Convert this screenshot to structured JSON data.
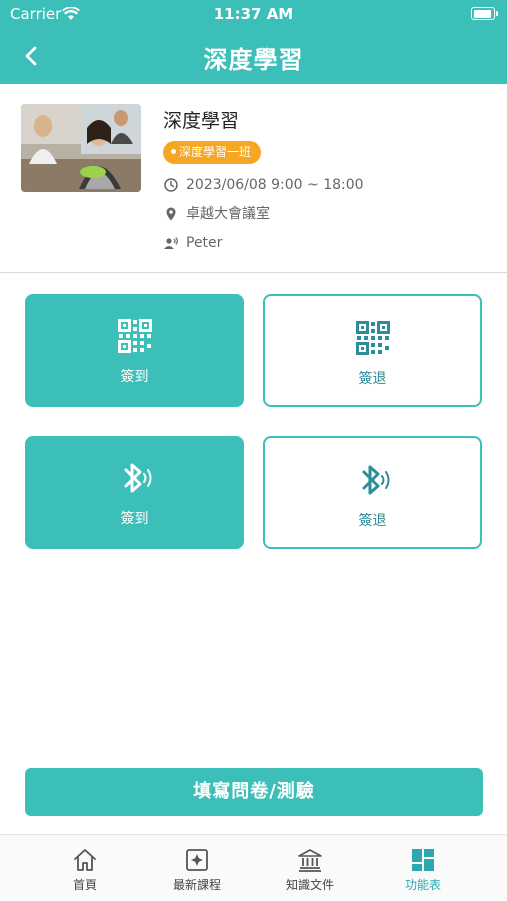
{
  "status_bar": {
    "carrier": "Carrier",
    "time": "11:37 AM"
  },
  "nav": {
    "title": "深度學習"
  },
  "course": {
    "title": "深度學習",
    "class_badge": "深度學習一班",
    "datetime": "2023/06/08 9:00 ~ 18:00",
    "location": "卓越大會議室",
    "instructor": "Peter"
  },
  "actions": [
    {
      "label": "簽到",
      "icon": "qr-code-icon",
      "style": "filled"
    },
    {
      "label": "簽退",
      "icon": "qr-code-icon",
      "style": "outline"
    },
    {
      "label": "簽到",
      "icon": "bluetooth-icon",
      "style": "filled"
    },
    {
      "label": "簽退",
      "icon": "bluetooth-icon",
      "style": "outline"
    }
  ],
  "survey_button": {
    "label": "填寫問卷/測驗"
  },
  "tabs": [
    {
      "label": "首頁",
      "icon": "home-icon",
      "active": false
    },
    {
      "label": "最新課程",
      "icon": "new-course-icon",
      "active": false
    },
    {
      "label": "知識文件",
      "icon": "library-icon",
      "active": false
    },
    {
      "label": "功能表",
      "icon": "grid-menu-icon",
      "active": true
    }
  ],
  "colors": {
    "primary": "#3bbfb8",
    "badge": "#f5a623",
    "outline_text": "#2d8d99",
    "active_tab": "#2ea7b0"
  }
}
